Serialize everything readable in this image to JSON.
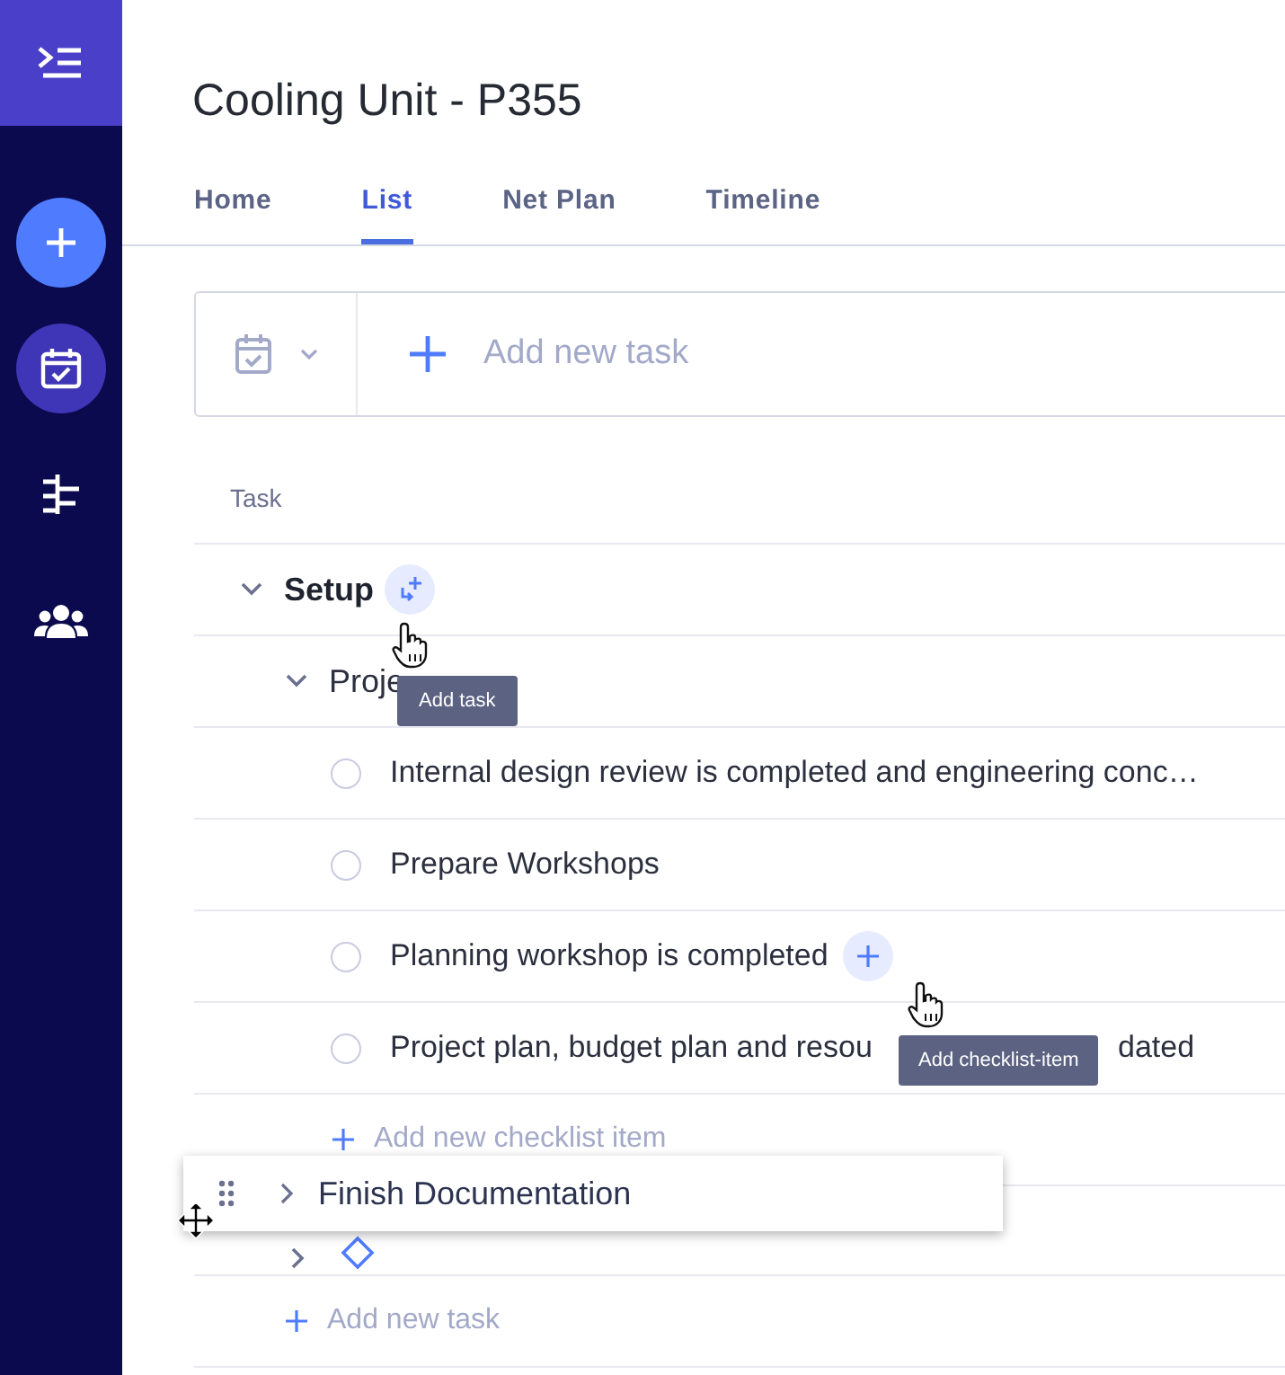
{
  "sidebar": {
    "items": [
      {
        "kind": "menu"
      },
      {
        "kind": "create"
      },
      {
        "kind": "tasks",
        "selected": true
      },
      {
        "kind": "timeline",
        "selected": false
      },
      {
        "kind": "team",
        "selected": false
      }
    ]
  },
  "title": "Cooling Unit - P355",
  "tabs": [
    {
      "label": "Home",
      "selected": false
    },
    {
      "label": "List",
      "selected": true
    },
    {
      "label": "Net Plan",
      "selected": false
    },
    {
      "label": "Timeline",
      "selected": false
    }
  ],
  "add_task": {
    "placeholder": "Add new task"
  },
  "table": {
    "columns": [
      "Task"
    ]
  },
  "tree": [
    {
      "name": "Setup",
      "kind": "group",
      "expanded": true,
      "hover_add": {
        "tooltip": "Add task"
      },
      "children": [
        {
          "name": "Proje",
          "kind": "task",
          "expanded": true,
          "checklist": [
            {
              "text": "Internal design review is completed and engineering conc…",
              "done": false
            },
            {
              "text": "Prepare Workshops",
              "done": false
            },
            {
              "text": "Planning workshop is completed",
              "done": false,
              "hover_add": {
                "tooltip": "Add checklist-item"
              }
            },
            {
              "text": "Project plan, budget plan and resou",
              "text_after_tooltip": "dated",
              "done": false
            }
          ],
          "add_checklist": "Add new checklist item"
        },
        {
          "kind": "milestone",
          "expanded": false,
          "dragged_over_by": "Finish Documentation"
        }
      ]
    }
  ],
  "add_new_task": "Add new task"
}
